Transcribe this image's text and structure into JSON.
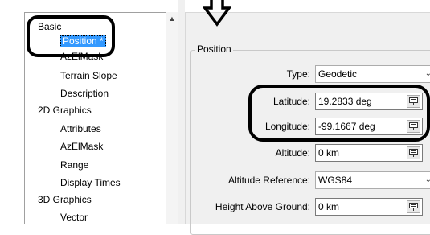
{
  "tree": {
    "items": [
      {
        "label": "Basic",
        "level": 0
      },
      {
        "label": "Position *",
        "level": 1,
        "selected": true
      },
      {
        "label": "AzElMask",
        "level": 1
      },
      {
        "label": "Terrain Slope",
        "level": 1
      },
      {
        "label": "Description",
        "level": 1
      },
      {
        "label": "2D Graphics",
        "level": 0
      },
      {
        "label": "Attributes",
        "level": 1
      },
      {
        "label": "AzElMask",
        "level": 1
      },
      {
        "label": "Range",
        "level": 1
      },
      {
        "label": "Display Times",
        "level": 1
      },
      {
        "label": "3D Graphics",
        "level": 0
      },
      {
        "label": "Vector",
        "level": 1
      }
    ]
  },
  "position_group": {
    "title": "Position",
    "type": {
      "label": "Type:",
      "value": "Geodetic"
    },
    "latitude": {
      "label": "Latitude:",
      "value": "19.2833 deg"
    },
    "longitude": {
      "label": "Longitude:",
      "value": "-99.1667 deg"
    },
    "altitude": {
      "label": "Altitude:",
      "value": "0 km"
    },
    "altitude_reference": {
      "label": "Altitude Reference:",
      "value": "WGS84"
    },
    "height_above_ground": {
      "label": "Height Above Ground:",
      "value": "0 km"
    }
  },
  "colors": {
    "selection": "#3399ff",
    "annotation": "#000000"
  },
  "icons": {
    "unit_button": "units-keypad-icon",
    "dropdown": "chevron-down-icon",
    "scroll_up": "scroll-up-arrow-icon",
    "annotation_arrow": "outline-down-arrow-icon"
  }
}
